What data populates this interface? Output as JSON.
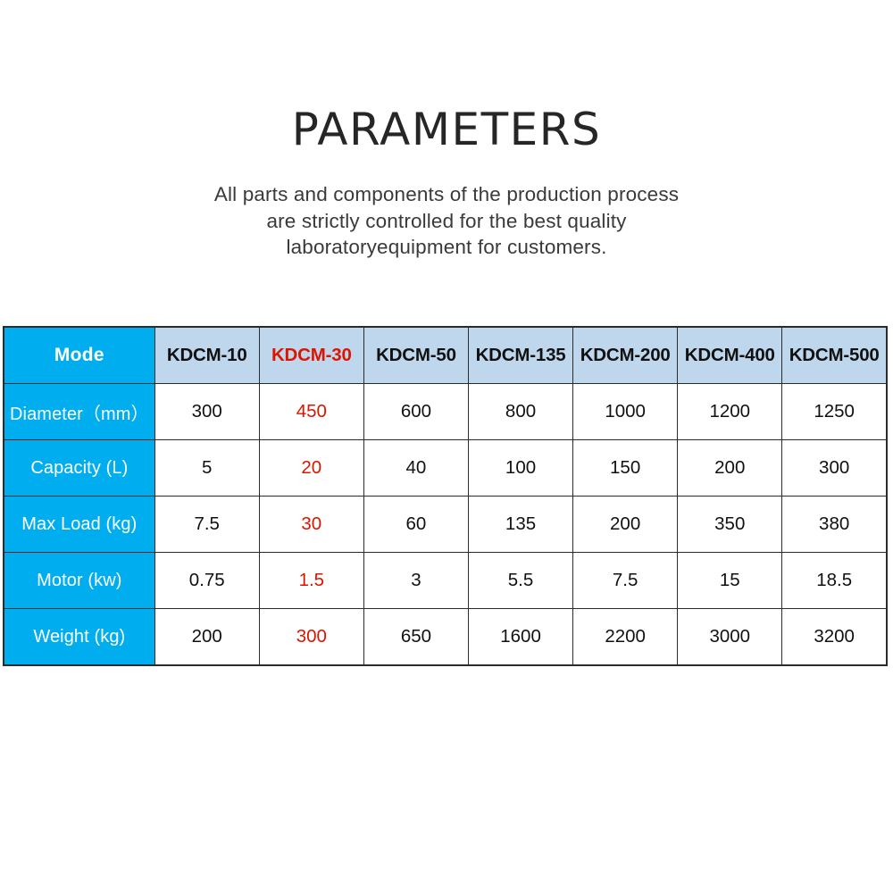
{
  "header": {
    "title": "PARAMETERS",
    "subtitle_lines": [
      "All parts and components of the production process",
      "are strictly controlled for the best quality",
      "laboratoryequipment for customers."
    ]
  },
  "colors": {
    "cyan": "#00AEEF",
    "light_blue": "#BFD7EC",
    "highlight_red": "#DD1500",
    "border": "#2b2b2b",
    "text": "#111111",
    "background": "#ffffff"
  },
  "table": {
    "corner_label": "Mode",
    "highlight_column_index": 1,
    "columns": [
      "KDCM-10",
      "KDCM-30",
      "KDCM-50",
      "KDCM-135",
      "KDCM-200",
      "KDCM-400",
      "KDCM-500"
    ],
    "rows": [
      {
        "label": "Diameter（mm）",
        "values": [
          "300",
          "450",
          "600",
          "800",
          "1000",
          "1200",
          "1250"
        ]
      },
      {
        "label": "Capacity (L)",
        "values": [
          "5",
          "20",
          "40",
          "100",
          "150",
          "200",
          "300"
        ]
      },
      {
        "label": "Max Load (kg)",
        "values": [
          "7.5",
          "30",
          "60",
          "135",
          "200",
          "350",
          "380"
        ]
      },
      {
        "label": "Motor (kw)",
        "values": [
          "0.75",
          "1.5",
          "3",
          "5.5",
          "7.5",
          "15",
          "18.5"
        ]
      },
      {
        "label": "Weight (kg)",
        "values": [
          "200",
          "300",
          "650",
          "1600",
          "2200",
          "3000",
          "3200"
        ]
      }
    ]
  }
}
